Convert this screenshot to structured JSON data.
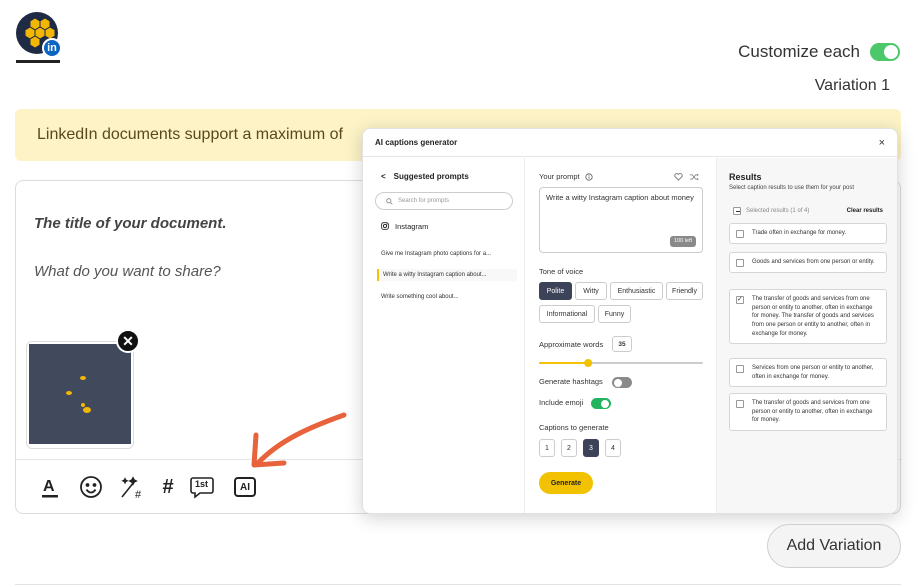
{
  "header": {
    "avatar_badge": "in",
    "customize_label": "Customize each",
    "variation_label": "Variation 1"
  },
  "warning": {
    "text": "LinkedIn documents support a maximum of"
  },
  "editor": {
    "title_placeholder": "The title of your document.",
    "body_placeholder": "What do you want to share?",
    "toolbar": {
      "hashtag": "#",
      "first_comment": "1st",
      "ai": "AI"
    }
  },
  "modal": {
    "title": "AI captions generator",
    "close": "×",
    "suggested": {
      "heading": "Suggested prompts",
      "back": "<",
      "search_placeholder": "Search for prompts",
      "category": "Instagram",
      "items": [
        "Give me Instagram photo captions for a...",
        "Write a witty Instagram caption about...",
        "Write something cool about..."
      ]
    },
    "prompt": {
      "label": "Your prompt",
      "value": "Write a witty Instagram caption about money",
      "left": "100 left"
    },
    "tone": {
      "label": "Tone of voice",
      "options": [
        "Polite",
        "Witty",
        "Enthusiastic",
        "Friendly",
        "Informational",
        "Funny"
      ]
    },
    "words": {
      "label": "Approximate words",
      "value": "35",
      "slider_fraction": 0.3
    },
    "hashtags_label": "Generate hashtags",
    "emoji_label": "Include emoji",
    "captions": {
      "label": "Captions to generate",
      "options": [
        "1",
        "2",
        "3",
        "4"
      ]
    },
    "generate_label": "Generate",
    "results": {
      "heading": "Results",
      "subtitle": "Select caption results to use them for your post",
      "selected": "Selected results (1 of 4)",
      "clear": "Clear results",
      "items": [
        "Trade often in exchange for money.",
        "Goods and services from one person or entity.",
        "The transfer of goods and services from one person or entity to another, often in exchange for money. The transfer of goods and services from one person or entity to another, often in exchange for money.",
        "Services from one person or entity to another, often in exchange for money.",
        "The transfer of goods and services from one person or entity to another, often in exchange for money."
      ]
    }
  },
  "footer": {
    "add_variation": "Add Variation"
  },
  "colors": {
    "accent_yellow": "#f2c200",
    "toggle_green": "#4cc76a",
    "warning_bg": "#fdf3c7",
    "arrow": "#e8623c",
    "linkedin": "#0a66c2"
  }
}
